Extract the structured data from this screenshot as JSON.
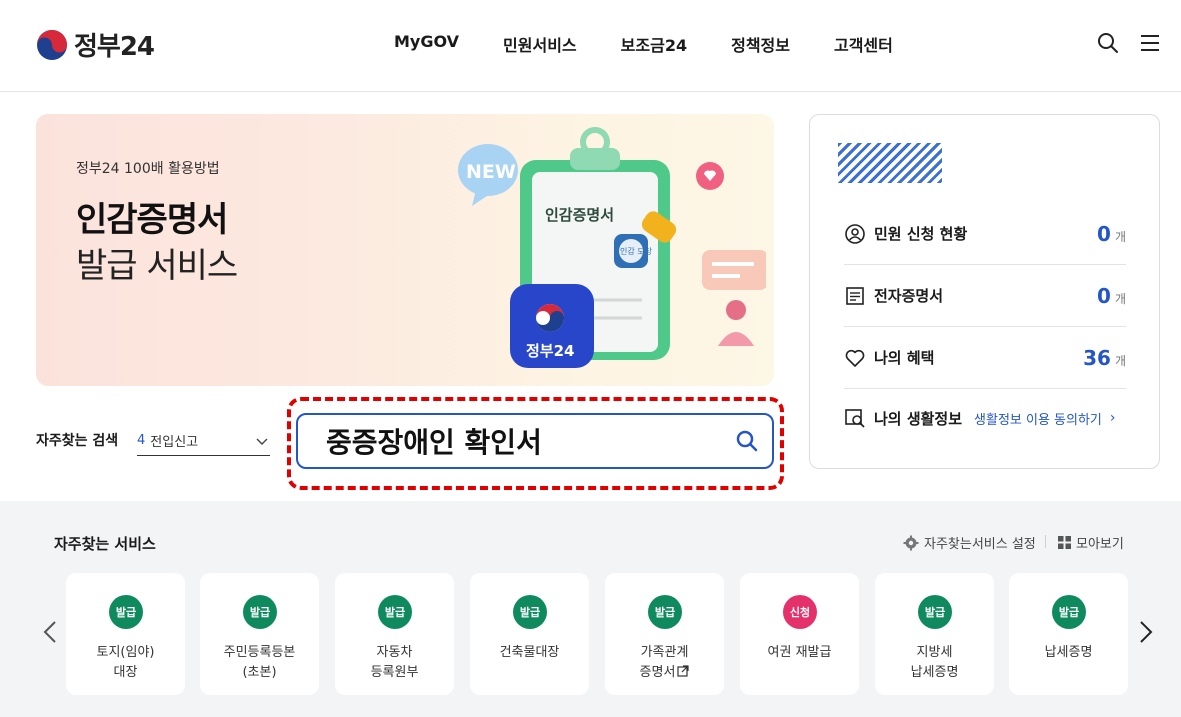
{
  "header": {
    "logo_text": "정부24",
    "nav": [
      "MyGOV",
      "민원서비스",
      "보조금24",
      "정책정보",
      "고객센터"
    ],
    "icons": [
      "search-icon",
      "menu-icon"
    ]
  },
  "banner": {
    "subtitle": "정부24 100배 활용방법",
    "title": "인감증명서",
    "title2": "발급 서비스",
    "art": {
      "new_badge": "NEW",
      "clipboard_label": "인감증명서",
      "stamp_text": "인감 도장",
      "app_icon_label": "정부24"
    }
  },
  "status_card": {
    "rows": [
      {
        "icon": "user-circle-icon",
        "label": "민원 신청 현황",
        "count": "0",
        "unit": "개"
      },
      {
        "icon": "document-icon",
        "label": "전자증명서",
        "count": "0",
        "unit": "개"
      },
      {
        "icon": "heart-icon",
        "label": "나의 혜택",
        "count": "36",
        "unit": "개"
      },
      {
        "icon": "life-search-icon",
        "label": "나의 생활정보",
        "link": "생활정보 이용 동의하기",
        "chevron": "›"
      }
    ]
  },
  "search": {
    "frequent_label": "자주찾는 검색",
    "frequent_num": "4",
    "frequent_text": "전입신고",
    "query": "중증장애인 확인서"
  },
  "services": {
    "title": "자주찾는 서비스",
    "settings_label": "자주찾는서비스 설정",
    "gather_label": "모아보기",
    "colors": {
      "issue": "#0f8a5f",
      "apply": "#e5316b"
    },
    "items": [
      {
        "badge": "발급",
        "type": "issue",
        "line1": "토지(임야)",
        "line2": "대장"
      },
      {
        "badge": "발급",
        "type": "issue",
        "line1": "주민등록등본",
        "line2": "(초본)"
      },
      {
        "badge": "발급",
        "type": "issue",
        "line1": "자동차",
        "line2": "등록원부"
      },
      {
        "badge": "발급",
        "type": "issue",
        "line1": "건축물대장",
        "line2": ""
      },
      {
        "badge": "발급",
        "type": "issue",
        "line1": "가족관계",
        "line2": "증명서",
        "external": true
      },
      {
        "badge": "신청",
        "type": "apply",
        "line1": "여권 재발급",
        "line2": ""
      },
      {
        "badge": "발급",
        "type": "issue",
        "line1": "지방세",
        "line2": "납세증명"
      },
      {
        "badge": "발급",
        "type": "issue",
        "line1": "납세증명",
        "line2": ""
      }
    ]
  }
}
